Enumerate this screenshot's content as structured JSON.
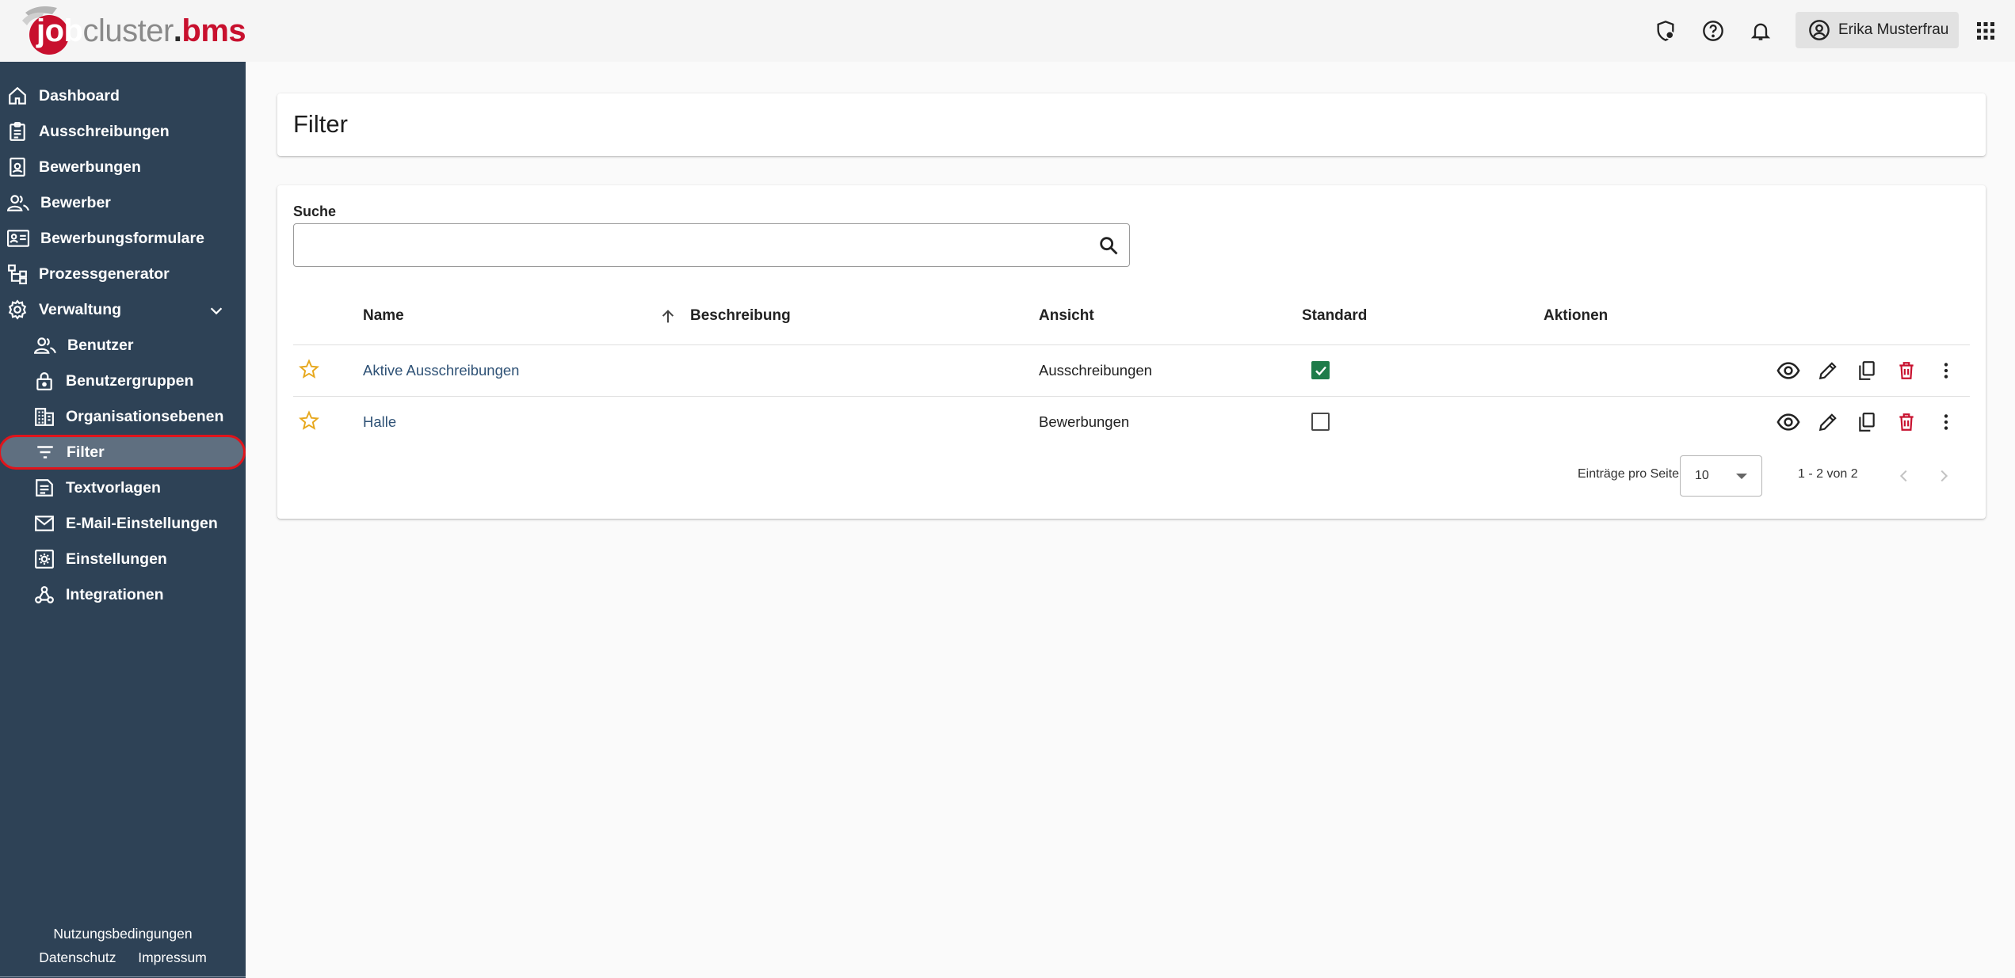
{
  "app": {
    "logo": {
      "part1": "job",
      "part2": "cluster",
      "part3": ".",
      "part4": "bms"
    },
    "header_icons": [
      "shield-clock-icon",
      "help-icon",
      "bell-icon",
      "apps-grid-icon"
    ],
    "user": {
      "name": "Erika Musterfrau"
    }
  },
  "sidebar": {
    "items": [
      {
        "label": "Dashboard",
        "icon": "home-icon"
      },
      {
        "label": "Ausschreibungen",
        "icon": "clipboard-icon"
      },
      {
        "label": "Bewerbungen",
        "icon": "document-person-icon"
      },
      {
        "label": "Bewerber",
        "icon": "people-icon"
      },
      {
        "label": "Bewerbungsformulare",
        "icon": "id-card-icon"
      },
      {
        "label": "Prozessgenerator",
        "icon": "hierarchy-icon"
      },
      {
        "label": "Verwaltung",
        "icon": "gear-icon",
        "expanded": true
      },
      {
        "label": "Benutzer",
        "icon": "people-icon"
      },
      {
        "label": "Benutzergruppen",
        "icon": "lock-icon"
      },
      {
        "label": "Organisationsebenen",
        "icon": "building-icon"
      },
      {
        "label": "Filter",
        "icon": "filter-icon",
        "active": true
      },
      {
        "label": "Textvorlagen",
        "icon": "text-document-icon"
      },
      {
        "label": "E-Mail-Einstellungen",
        "icon": "mail-icon"
      },
      {
        "label": "Einstellungen",
        "icon": "settings-box-icon"
      },
      {
        "label": "Integrationen",
        "icon": "webhook-icon"
      }
    ],
    "footer": {
      "terms": "Nutzungsbedingungen",
      "privacy": "Datenschutz",
      "imprint": "Impressum"
    }
  },
  "page": {
    "title": "Filter"
  },
  "search": {
    "label": "Suche",
    "value": "",
    "placeholder": ""
  },
  "table": {
    "columns": [
      "Name",
      "Beschreibung",
      "Ansicht",
      "Standard",
      "Aktionen"
    ],
    "sort": {
      "column": "Name",
      "direction": "ascending"
    },
    "rows": [
      {
        "name": "Aktive Ausschreibungen",
        "description": "",
        "view": "Ausschreibungen",
        "standard": true
      },
      {
        "name": "Halle",
        "description": "",
        "view": "Bewerbungen",
        "standard": false
      }
    ]
  },
  "pagination": {
    "per_page_label": "Einträge pro Seite",
    "per_page": "10",
    "range": "1 - 2 von 2"
  },
  "colors": {
    "sidebar_bg": "#2e4256",
    "active_item_bg": "#5f6f80",
    "highlight_outline": "#e0141b",
    "brand_red": "#c8102e",
    "checkbox_green": "#1e7c4a",
    "delete_red": "#c8102e",
    "star_gold": "#e7a81e",
    "link_blue": "#2f5276"
  }
}
